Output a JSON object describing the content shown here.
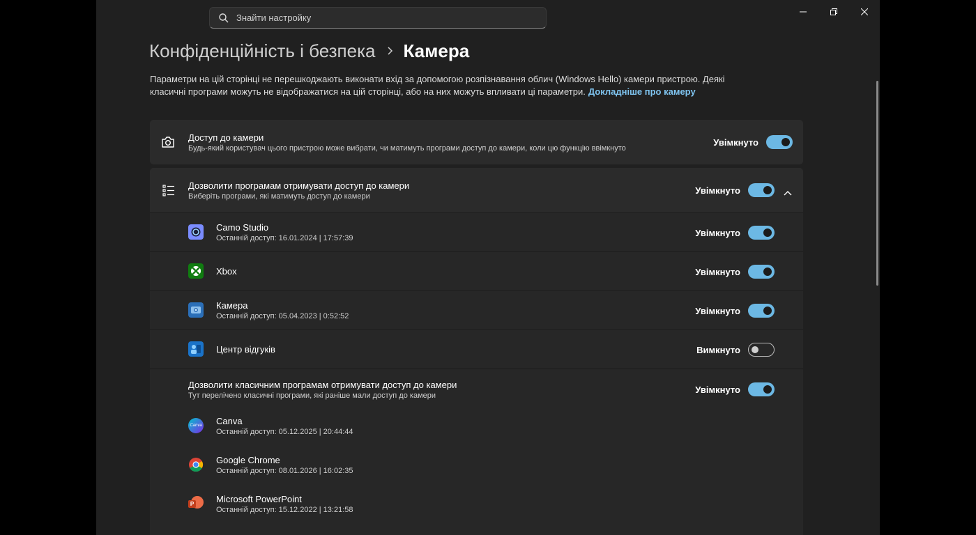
{
  "search": {
    "placeholder": "Знайти настройку"
  },
  "breadcrumb": {
    "parent": "Конфіденційність і безпека",
    "current": "Камера"
  },
  "description": {
    "text": "Параметри на цій сторінці не перешкоджають виконати вхід за допомогою розпізнавання облич (Windows Hello) камери пристрою. Деякі класичні програми можуть не відображатися на цій сторінці, або на них можуть впливати ці параметри.",
    "link": "Докладніше про камеру"
  },
  "camera_access": {
    "title": "Доступ до камери",
    "subtitle": "Будь-який користувач цього пристрою може вибрати, чи матимуть програми доступ до камери, коли цю функцію ввімкнуто",
    "state": "Увімкнуто"
  },
  "apps_access": {
    "title": "Дозволити програмам отримувати доступ до камери",
    "subtitle": "Виберіть програми, які матимуть доступ до камери",
    "state": "Увімкнуто"
  },
  "apps": [
    {
      "name": "Camo Studio",
      "last_access": "Останній доступ: 16.01.2024  |  17:57:39",
      "state": "Увімкнуто",
      "icon": "camo-studio-icon"
    },
    {
      "name": "Xbox",
      "last_access": "",
      "state": "Увімкнуто",
      "icon": "xbox-icon"
    },
    {
      "name": "Камера",
      "last_access": "Останній доступ: 05.04.2023  |  0:52:52",
      "state": "Увімкнуто",
      "icon": "camera-app-icon"
    },
    {
      "name": "Центр відгуків",
      "last_access": "",
      "state": "Вимкнуто",
      "icon": "feedback-hub-icon"
    }
  ],
  "desktop_apps_access": {
    "title": "Дозволити класичним програмам отримувати доступ до камери",
    "subtitle": "Тут перелічено класичні програми, які раніше мали доступ до камери",
    "state": "Увімкнуто"
  },
  "desktop_apps": [
    {
      "name": "Canva",
      "last_access": "Останній доступ: 05.12.2025  |  20:44:44",
      "icon": "canva-icon",
      "icon_text": "Canva"
    },
    {
      "name": "Google Chrome",
      "last_access": "Останній доступ: 08.01.2026  |  16:02:35",
      "icon": "chrome-icon"
    },
    {
      "name": "Microsoft PowerPoint",
      "last_access": "Останній доступ: 15.12.2022  |  13:21:58",
      "icon": "powerpoint-icon",
      "icon_text": "P"
    }
  ],
  "colors": {
    "accent": "#6cb8e4",
    "link": "#7fc4f0",
    "window_bg": "#202020",
    "card_bg": "#2b2b2b"
  }
}
